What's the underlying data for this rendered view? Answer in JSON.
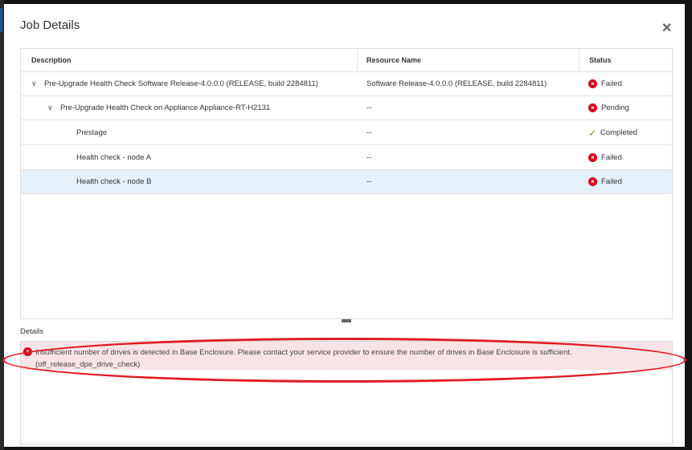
{
  "dialog": {
    "title": "Job Details",
    "close_icon": "close-icon"
  },
  "table": {
    "headers": [
      "Description",
      "Resource Name",
      "Status"
    ],
    "rows": [
      {
        "description": "Pre-Upgrade Health Check Software Release-4.0.0.0 (RELEASE, build 2284811)",
        "resource": "Software Release-4.0.0.0 (RELEASE, build 2284811)",
        "status": "Failed",
        "status_icon": "error-icon"
      },
      {
        "description": "Pre-Upgrade Health Check on Appliance Appliance-RT-H2131",
        "resource": "--",
        "status": "Pending",
        "status_icon": "error-icon"
      },
      {
        "description": "Prestage",
        "resource": "--",
        "status": "Completed",
        "status_icon": "check-icon"
      },
      {
        "description": "Health check - node A",
        "resource": "--",
        "status": "Failed",
        "status_icon": "error-icon"
      },
      {
        "description": "Health check - node B",
        "resource": "--",
        "status": "Failed",
        "status_icon": "error-icon"
      }
    ]
  },
  "details": {
    "label": "Details",
    "message": "Insufficient number of drives is detected in Base Enclosure. Please contact your service provider to ensure the number of drives in Base Enclosure is sufficient.",
    "code": "(off_release_dpe_drive_check)"
  },
  "colors": {
    "error": "#d0021b",
    "success": "#6a9a1f",
    "selected_row": "#e6f0f9",
    "error_bg": "#f8e4e6",
    "annotation": "#e01b24"
  }
}
